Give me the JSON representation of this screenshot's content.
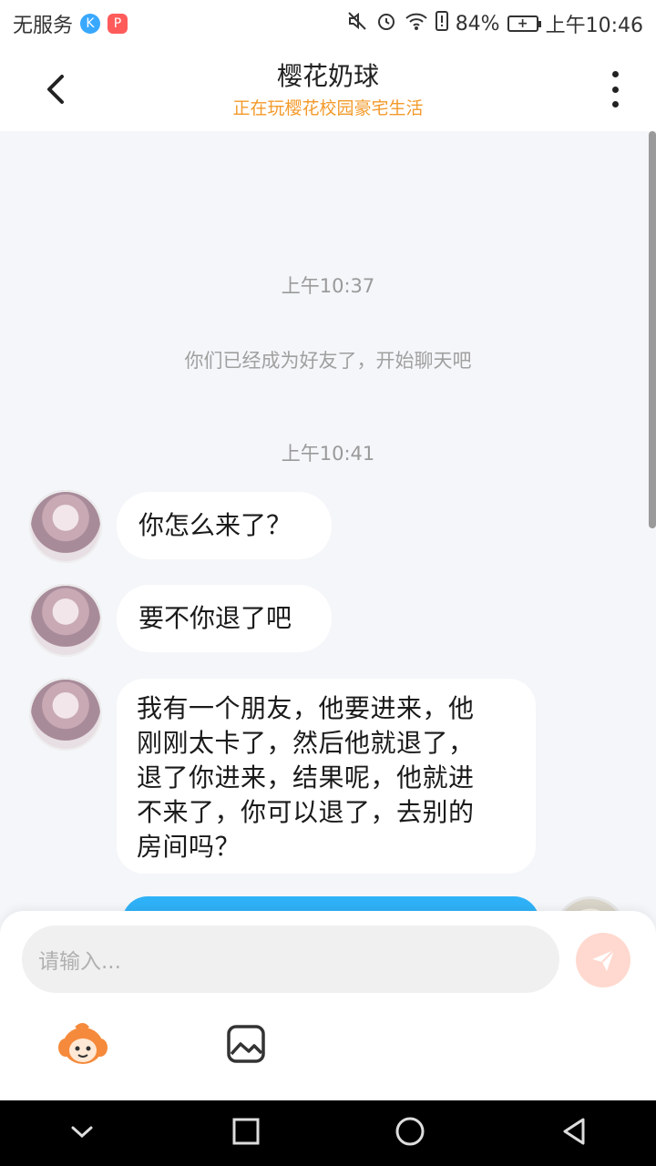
{
  "status_bar": {
    "carrier": "无服务",
    "battery_percent": "84%",
    "battery_glyph": "+",
    "time": "上午10:46",
    "app_k": "K",
    "app_p": "P"
  },
  "header": {
    "title": "樱花奶球",
    "subtitle": "正在玩樱花校园豪宅生活"
  },
  "chat": {
    "timestamp_1": "上午10:37",
    "system_message": "你们已经成为好友了，开始聊天吧",
    "timestamp_2": "上午10:41",
    "messages": [
      {
        "text": "你怎么来了？"
      },
      {
        "text": "要不你退了吧"
      },
      {
        "lines": [
          "我有一个朋友，他要进来，他",
          "刚刚太卡了，然后他就退了，",
          "退了你进来，结果呢，他就进",
          "不来了，你可以退了，去别的",
          "房间吗？"
        ]
      }
    ]
  },
  "input": {
    "placeholder": "请输入..."
  },
  "colors": {
    "accent_orange": "#f39a2b",
    "my_bubble": "#2fb1f7",
    "send_button": "#ffd9cf"
  }
}
